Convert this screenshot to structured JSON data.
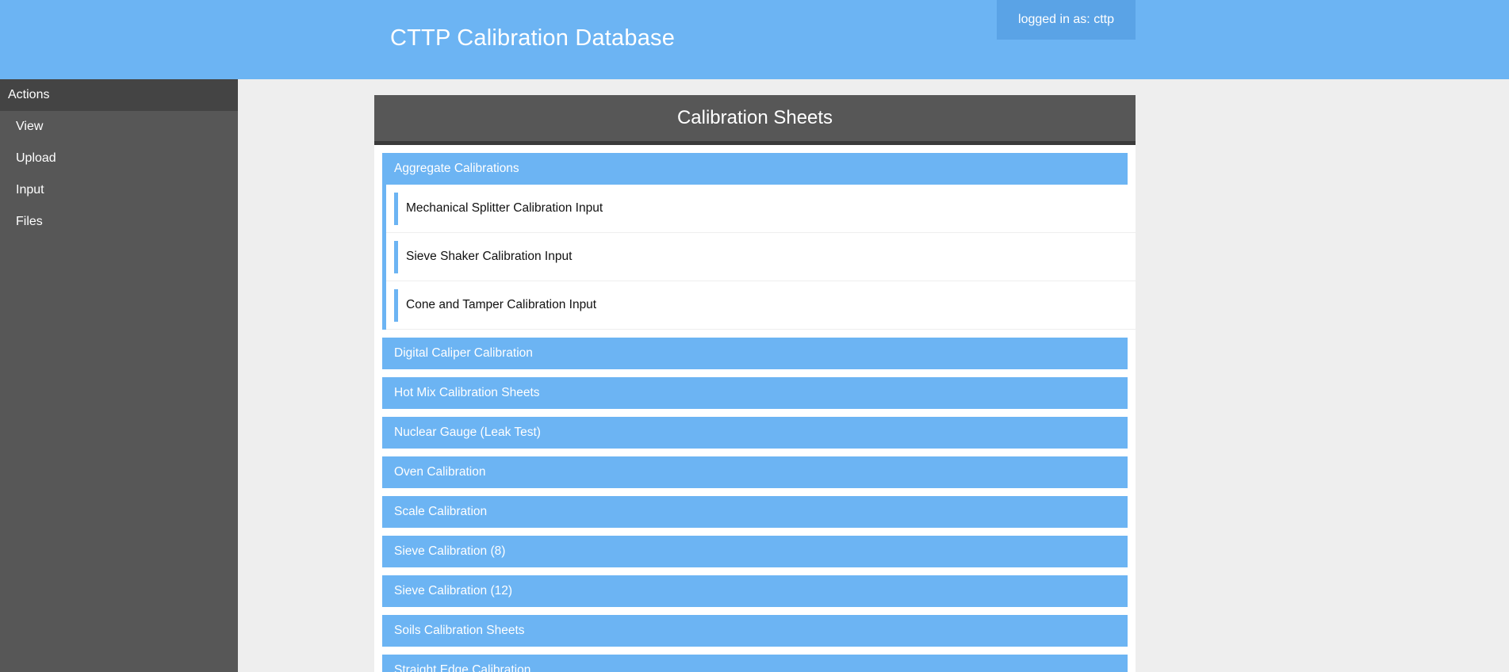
{
  "header": {
    "title": "CTTP Calibration Database",
    "login_status": "logged in as: cttp"
  },
  "sidebar": {
    "header": "Actions",
    "items": [
      {
        "label": "View"
      },
      {
        "label": "Upload"
      },
      {
        "label": "Input"
      },
      {
        "label": "Files"
      }
    ]
  },
  "main": {
    "panel_title": "Calibration Sheets",
    "categories": [
      {
        "label": "Aggregate Calibrations",
        "expanded": true,
        "items": [
          {
            "label": "Mechanical Splitter Calibration Input"
          },
          {
            "label": "Sieve Shaker Calibration Input"
          },
          {
            "label": "Cone and Tamper Calibration Input"
          }
        ]
      },
      {
        "label": "Digital Caliper Calibration"
      },
      {
        "label": "Hot Mix Calibration Sheets"
      },
      {
        "label": "Nuclear Gauge (Leak Test)"
      },
      {
        "label": "Oven Calibration"
      },
      {
        "label": "Scale Calibration"
      },
      {
        "label": "Sieve Calibration (8)"
      },
      {
        "label": "Sieve Calibration (12)"
      },
      {
        "label": "Soils Calibration Sheets"
      },
      {
        "label": "Straight Edge Calibration"
      }
    ]
  },
  "colors": {
    "accent": "#6cb4f3",
    "sidebar_bg": "#575757",
    "panel_header_bg": "#575757",
    "page_bg": "#eeeeee"
  }
}
